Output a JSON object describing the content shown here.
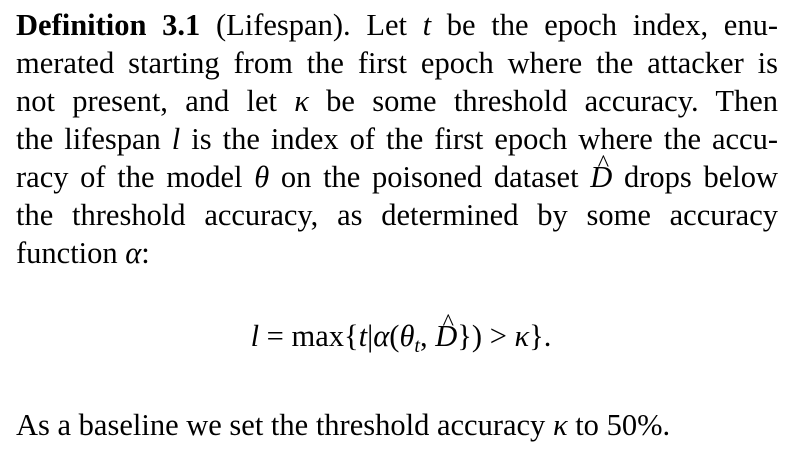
{
  "definition": {
    "label": "Definition 3.1",
    "name": "(Lifespan).",
    "lines": [
      [
        "Let ",
        "t",
        " be the epoch index, enu-"
      ],
      [
        "merated starting from the first epoch where the attacker is"
      ],
      [
        "not present, and let ",
        "κ",
        " be some threshold accuracy.  Then"
      ],
      [
        "the lifespan ",
        "l",
        " is the index of the first epoch where the accu-"
      ],
      [
        "racy of the model ",
        "θ",
        " on the poisoned dataset ",
        "D",
        " drops below"
      ],
      [
        "the threshold accuracy, as determined by some accuracy"
      ],
      [
        "function ",
        "α",
        ":"
      ]
    ]
  },
  "equation": {
    "lhs": "l",
    "equals": " = ",
    "op": "max",
    "open": "{",
    "t": "t",
    "bar": "|",
    "alpha": "α",
    "paren_open": "(",
    "theta": "θ",
    "theta_sub": "t",
    "comma": ", ",
    "D": "D",
    "paren_close": ")",
    "gt": " > ",
    "kappa": "κ",
    "close": "}."
  },
  "baseline": {
    "prefix": "As a baseline we set the threshold accuracy ",
    "kappa": "κ",
    "middle": " to ",
    "value": "50%",
    "suffix": "."
  }
}
